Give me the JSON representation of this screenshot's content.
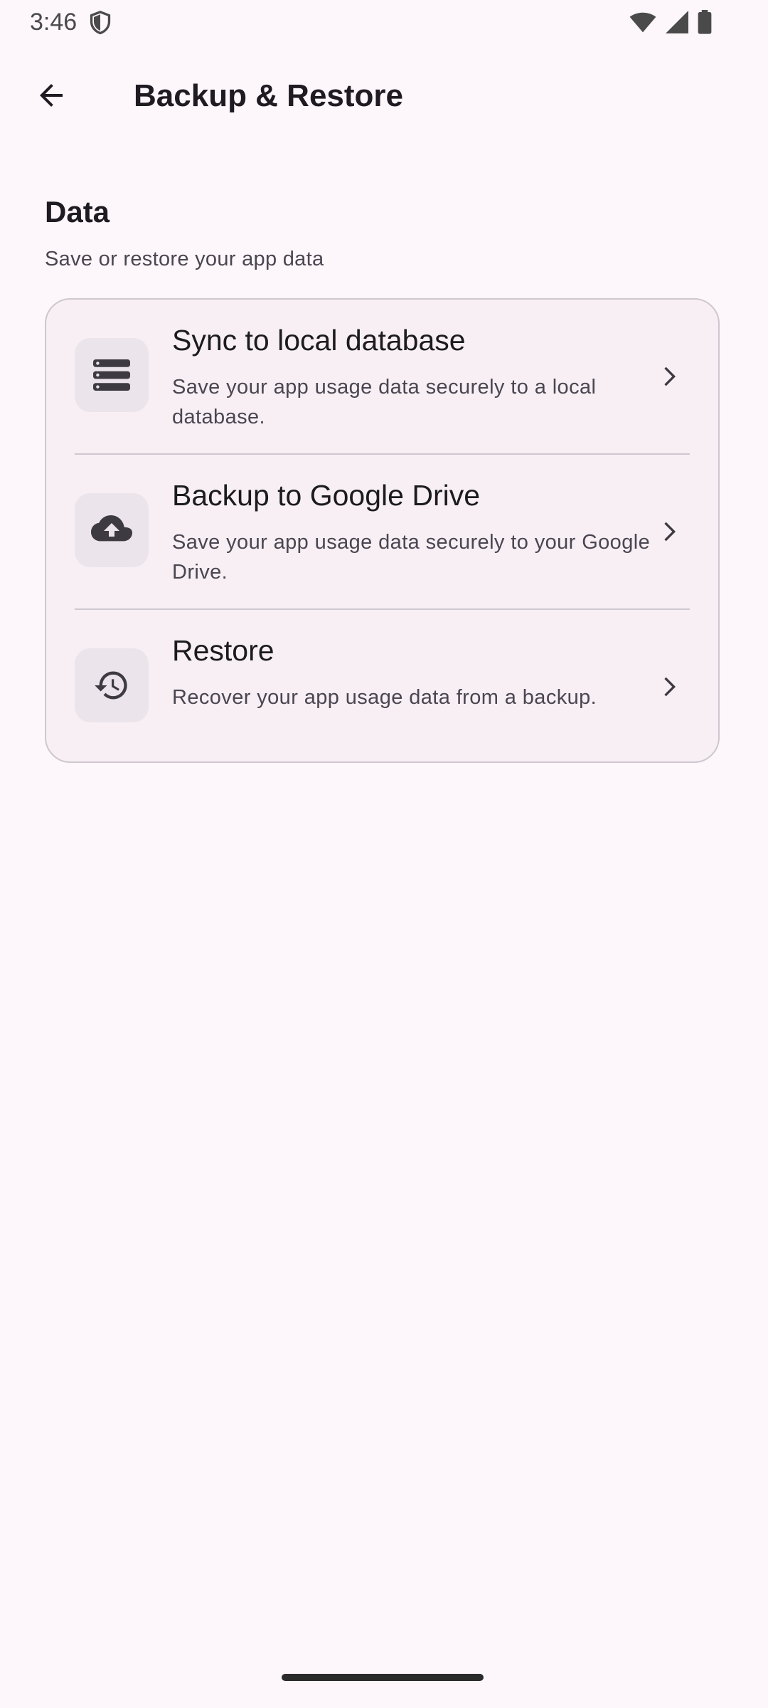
{
  "status_bar": {
    "time": "3:46",
    "icons": [
      "shield-icon",
      "wifi-icon",
      "signal-icon",
      "battery-icon"
    ]
  },
  "app_bar": {
    "title": "Backup & Restore",
    "back_icon": "arrow-back-icon"
  },
  "section": {
    "title": "Data",
    "subtitle": "Save or restore your app data"
  },
  "options": [
    {
      "title": "Sync to local database",
      "description": "Save your app usage data securely to a local database.",
      "icon": "database-icon"
    },
    {
      "title": "Backup to Google Drive",
      "description": "Save your app usage data securely to your Google Drive.",
      "icon": "cloud-upload-icon"
    },
    {
      "title": "Restore",
      "description": "Recover your app usage data from a backup.",
      "icon": "history-icon"
    }
  ],
  "colors": {
    "background": "#fdf6fa",
    "card": "#f7eff4",
    "icon_box": "#ebe4ea",
    "text_primary": "#1c1b1f",
    "text_secondary": "#4a4651"
  }
}
